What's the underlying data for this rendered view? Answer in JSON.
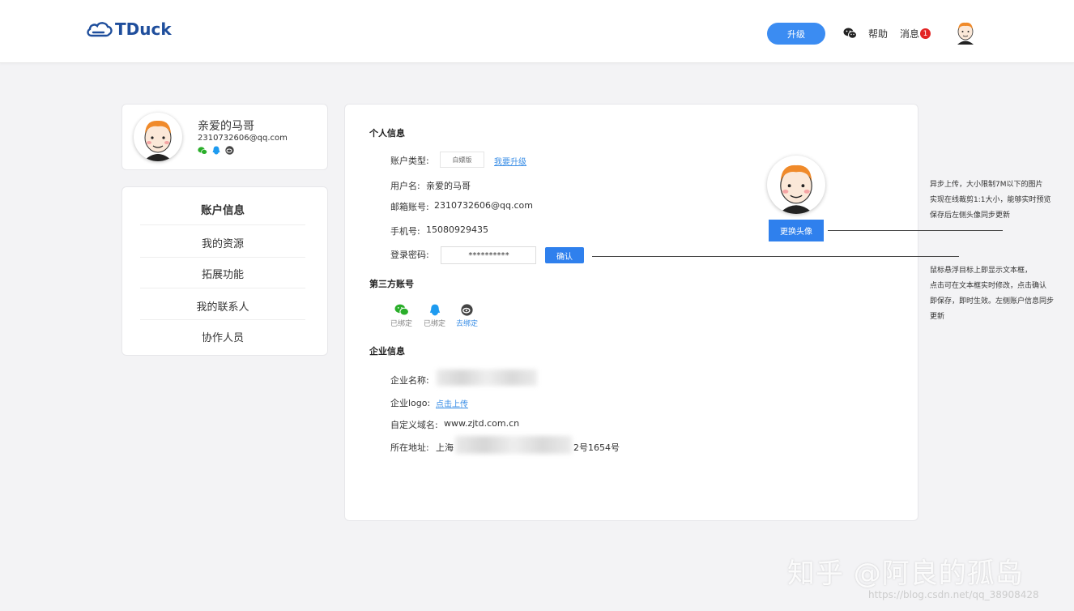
{
  "header": {
    "logo_text": "TDuck",
    "upgrade_label": "升级",
    "help_label": "帮助",
    "message_label": "消息",
    "message_count": "1"
  },
  "profile": {
    "name": "亲爱的马哥",
    "email": "2310732606@qq.com"
  },
  "menu": {
    "items": [
      {
        "label": "账户信息"
      },
      {
        "label": "我的资源"
      },
      {
        "label": "拓展功能"
      },
      {
        "label": "我的联系人"
      },
      {
        "label": "协作人员"
      }
    ]
  },
  "personal": {
    "section_title": "个人信息",
    "account_type_label": "账户类型:",
    "account_type_value": "白嫖版",
    "upgrade_link": "我要升级",
    "username_label": "用户名:",
    "username_value": "亲爱的马哥",
    "email_label": "邮箱账号:",
    "email_value": "2310732606@qq.com",
    "phone_label": "手机号:",
    "phone_value": "15080929435",
    "password_label": "登录密码:",
    "password_value": "**********",
    "confirm_label": "确认",
    "change_avatar_label": "更换头像"
  },
  "third_party": {
    "section_title": "第三方账号",
    "accounts": [
      {
        "icon": "wechat-icon",
        "status": "已绑定"
      },
      {
        "icon": "qq-icon",
        "status": "已绑定"
      },
      {
        "icon": "weibo-icon",
        "status": "去绑定"
      }
    ]
  },
  "enterprise": {
    "section_title": "企业信息",
    "name_label": "企业名称:",
    "logo_label": "企业logo:",
    "logo_link": "点击上传",
    "domain_label": "自定义域名:",
    "domain_value": "www.zjtd.com.cn",
    "address_label": "所在地址:",
    "address_prefix": "上海",
    "address_suffix": "2号1654号"
  },
  "annotations": {
    "avatar_note": [
      "异步上传，大小限制7M以下的图片",
      "实现在线裁剪1:1大小，能够实时预览",
      "保存后左侧头像同步更新"
    ],
    "password_note": [
      "鼠标悬浮目标上即显示文本框，",
      "点击可在文本框实时修改，点击确认",
      "即保存，即时生效。左侧账户信息同步",
      "更新"
    ]
  },
  "watermark": {
    "main": "知乎 @阿良的孤岛",
    "url": "https://blog.csdn.net/qq_38908428"
  },
  "colors": {
    "primary": "#2f80ed",
    "logo": "#1f4e9c",
    "wechat": "#2aae2a",
    "qq": "#1e9bf0",
    "badge": "#e32424"
  }
}
